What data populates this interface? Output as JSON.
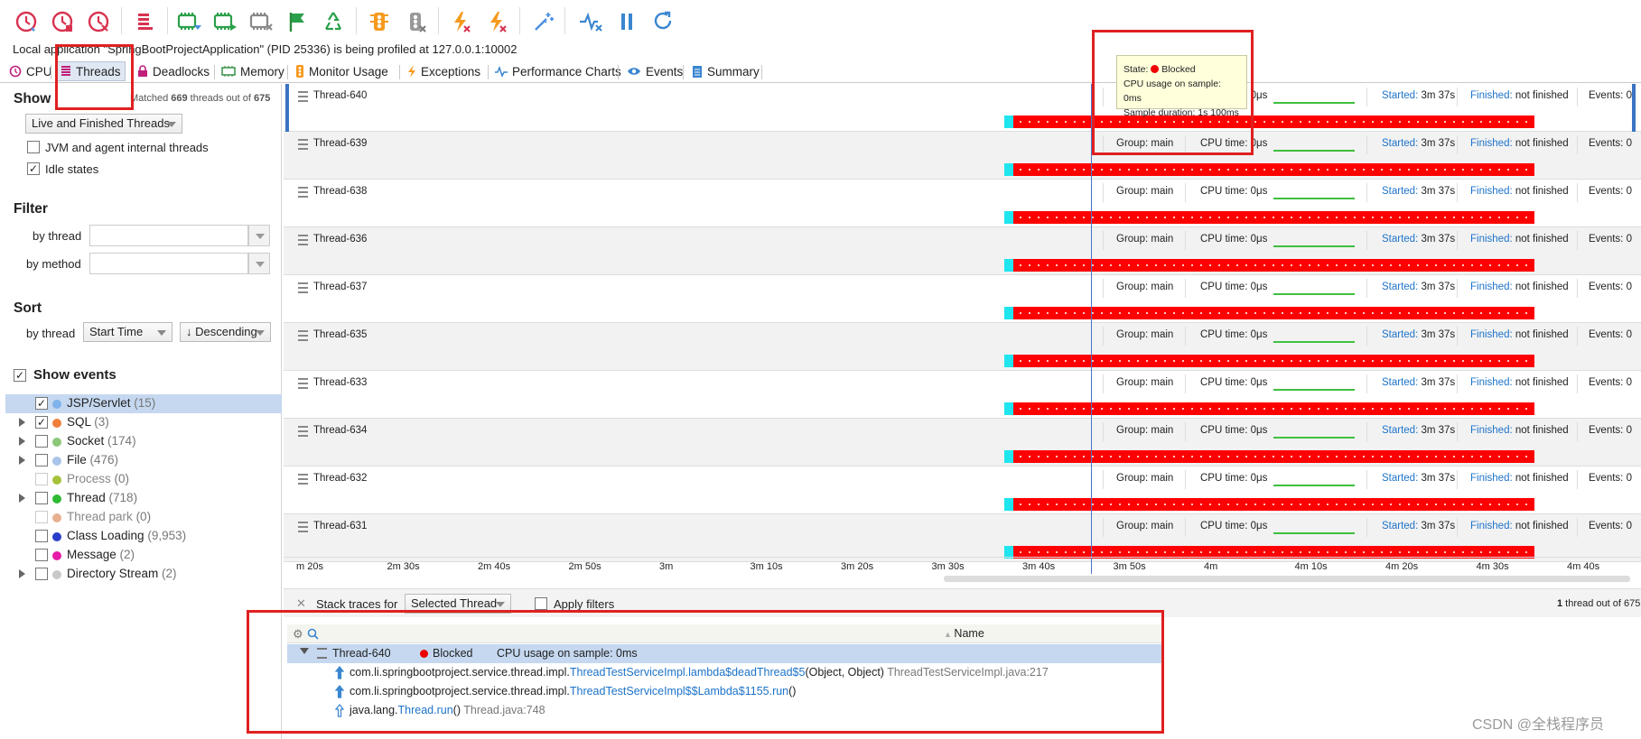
{
  "toolbar": {
    "icons": [
      "cpu-record-icon",
      "cpu-stop-icon",
      "cpu-clear-icon",
      "memory-icon",
      "record-alloc-icon",
      "start-tracking-icon",
      "stop-tracking-icon",
      "flag-icon",
      "recycle-icon",
      "monitor-on-icon",
      "monitor-off-icon",
      "exceptions-icon",
      "exceptions-off-icon",
      "magic-wand-icon",
      "heartbeat-icon",
      "pause-icon",
      "refresh-icon"
    ]
  },
  "status": "Local application \"SpringBootProjectApplication\" (PID 25336) is being profiled at 127.0.0.1:10002",
  "tabs": [
    {
      "label": "CPU"
    },
    {
      "label": "Threads"
    },
    {
      "label": "Deadlocks"
    },
    {
      "label": "Memory"
    },
    {
      "label": "Monitor Usage"
    },
    {
      "label": "Exceptions"
    },
    {
      "label": "Performance Charts"
    },
    {
      "label": "Events"
    },
    {
      "label": "Summary"
    }
  ],
  "left": {
    "show_title": "Show",
    "matched_prefix": "Matched ",
    "matched_count": "669",
    "matched_mid": " threads out of ",
    "matched_total": "675",
    "thread_filter": "Live and Finished Threads",
    "jvm_internal": "JVM and agent internal threads",
    "idle_states": "Idle states",
    "filter_title": "Filter",
    "by_thread": "by thread",
    "by_method": "by method",
    "sort_title": "Sort",
    "sort_by": "by thread",
    "sort_field": "Start Time",
    "sort_order": "↓ Descending",
    "show_events": "Show events",
    "events": [
      {
        "name": "JSP/Servlet",
        "count": "(15)",
        "color": "#7fb2ea",
        "checked": true,
        "expandable": false,
        "selected": true
      },
      {
        "name": "SQL",
        "count": "(3)",
        "color": "#f07f3c",
        "checked": true,
        "expandable": true
      },
      {
        "name": "Socket",
        "count": "(174)",
        "color": "#8cc878",
        "checked": false,
        "expandable": true
      },
      {
        "name": "File",
        "count": "(476)",
        "color": "#a8c4e8",
        "checked": false,
        "expandable": true
      },
      {
        "name": "Process",
        "count": "(0)",
        "color": "#a6c23a",
        "checked": false,
        "expandable": false,
        "disabled": true
      },
      {
        "name": "Thread",
        "count": "(718)",
        "color": "#2fba34",
        "checked": false,
        "expandable": true
      },
      {
        "name": "Thread park",
        "count": "(0)",
        "color": "#e8b090",
        "checked": false,
        "expandable": false,
        "disabled": true
      },
      {
        "name": "Class Loading",
        "count": "(9,953)",
        "color": "#2a3fc8",
        "checked": false,
        "expandable": false
      },
      {
        "name": "Message",
        "count": "(2)",
        "color": "#e81aa8",
        "checked": false,
        "expandable": false
      },
      {
        "name": "Directory Stream",
        "count": "(2)",
        "color": "#c8c8c8",
        "checked": false,
        "expandable": true
      }
    ]
  },
  "threads": [
    {
      "name": "Thread-640",
      "group": "main",
      "cpu": "0μs",
      "started": "3m 37s",
      "finished": "not finished",
      "events": "0",
      "selected": true
    },
    {
      "name": "Thread-639",
      "group": "main",
      "cpu": "0μs",
      "started": "3m 37s",
      "finished": "not finished",
      "events": "0"
    },
    {
      "name": "Thread-638",
      "group": "main",
      "cpu": "0μs",
      "started": "3m 37s",
      "finished": "not finished",
      "events": "0"
    },
    {
      "name": "Thread-636",
      "group": "main",
      "cpu": "0μs",
      "started": "3m 37s",
      "finished": "not finished",
      "events": "0"
    },
    {
      "name": "Thread-637",
      "group": "main",
      "cpu": "0μs",
      "started": "3m 37s",
      "finished": "not finished",
      "events": "0"
    },
    {
      "name": "Thread-635",
      "group": "main",
      "cpu": "0μs",
      "started": "3m 37s",
      "finished": "not finished",
      "events": "0"
    },
    {
      "name": "Thread-633",
      "group": "main",
      "cpu": "0μs",
      "started": "3m 37s",
      "finished": "not finished",
      "events": "0"
    },
    {
      "name": "Thread-634",
      "group": "main",
      "cpu": "0μs",
      "started": "3m 37s",
      "finished": "not finished",
      "events": "0"
    },
    {
      "name": "Thread-632",
      "group": "main",
      "cpu": "0μs",
      "started": "3m 37s",
      "finished": "not finished",
      "events": "0"
    },
    {
      "name": "Thread-631",
      "group": "main",
      "cpu": "0μs",
      "started": "3m 37s",
      "finished": "not finished",
      "events": "0"
    }
  ],
  "labels": {
    "group": "Group: ",
    "cpu_time": "CPU time: ",
    "started": "Started: ",
    "finished": "Finished: ",
    "events": "Events: "
  },
  "tooltip": {
    "state_label": "State: ",
    "state_value": "Blocked",
    "cpu_sample": "CPU usage on sample: 0ms",
    "duration": "Sample duration: 1s 100ms"
  },
  "axis": [
    "m 20s",
    "2m 30s",
    "2m 40s",
    "2m 50s",
    "3m",
    "3m 10s",
    "3m 20s",
    "3m 30s",
    "3m 40s",
    "3m 50s",
    "4m",
    "4m 10s",
    "4m 20s",
    "4m 30s",
    "4m 40s"
  ],
  "stack": {
    "label": "Stack traces for",
    "mode": "Selected Thread",
    "apply_filters": "Apply filters",
    "count_prefix": "1",
    "count_text": " thread out of 675",
    "name_header": "Name",
    "thread_row": {
      "name": "Thread-640",
      "state": "Blocked",
      "cpu": "CPU usage on sample: 0ms"
    },
    "frames": [
      {
        "pkg": "com.li.springbootproject.service.thread.impl.",
        "cls": "ThreadTestServiceImpl.lambda$deadThread$5",
        "args": "(Object, Object)",
        "loc": " ThreadTestServiceImpl.java:217"
      },
      {
        "pkg": "com.li.springbootproject.service.thread.impl.",
        "cls": "ThreadTestServiceImpl$$Lambda$1155.run",
        "args": "()",
        "loc": ""
      },
      {
        "pkg": "java.lang.",
        "cls": "Thread.run",
        "args": "()",
        "loc": " Thread.java:748"
      }
    ]
  },
  "watermark": "CSDN @全栈程序员"
}
